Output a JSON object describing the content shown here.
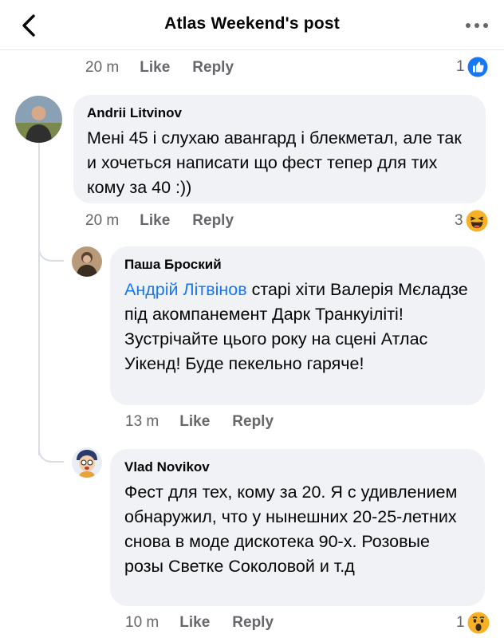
{
  "header": {
    "title": "Atlas Weekend's post"
  },
  "top_row": {
    "time": "20 m",
    "like": "Like",
    "reply": "Reply",
    "reaction_count": "1",
    "reaction_icon": "like-icon"
  },
  "comments": [
    {
      "author": "Andrii Litvinov",
      "text": "Мені 45 і слухаю авангард і блекметал, але так и хочеться написати що фест тепер для тих кому за 40 :))",
      "time": "20 m",
      "like": "Like",
      "reply": "Reply",
      "reaction_count": "3",
      "reaction_icon": "haha-icon"
    },
    {
      "author": "Паша Броский",
      "mention": "Андрій Літвінов",
      "text": " старі хіти Валерія Мєладзе під акомпанемент Дарк Транкуіліті! Зустрічайте цього року на сцені Атлас Уікенд! Буде пекельно гаряче!",
      "time": "13 m",
      "like": "Like",
      "reply": "Reply"
    },
    {
      "author": "Vlad Novikov",
      "text": "Фест для тех, кому за 20. Я с удивлением обнаружил, что у нынешних 20-25-летних снова в моде дискотека 90-х. Розовые розы Светке Соколовой и т.д",
      "time": "10 m",
      "like": "Like",
      "reply": "Reply",
      "reaction_count": "1",
      "reaction_icon": "wow-icon"
    }
  ],
  "colors": {
    "bubble": "#f0f2f5",
    "secondary_text": "#65676b",
    "link": "#1877f2"
  }
}
